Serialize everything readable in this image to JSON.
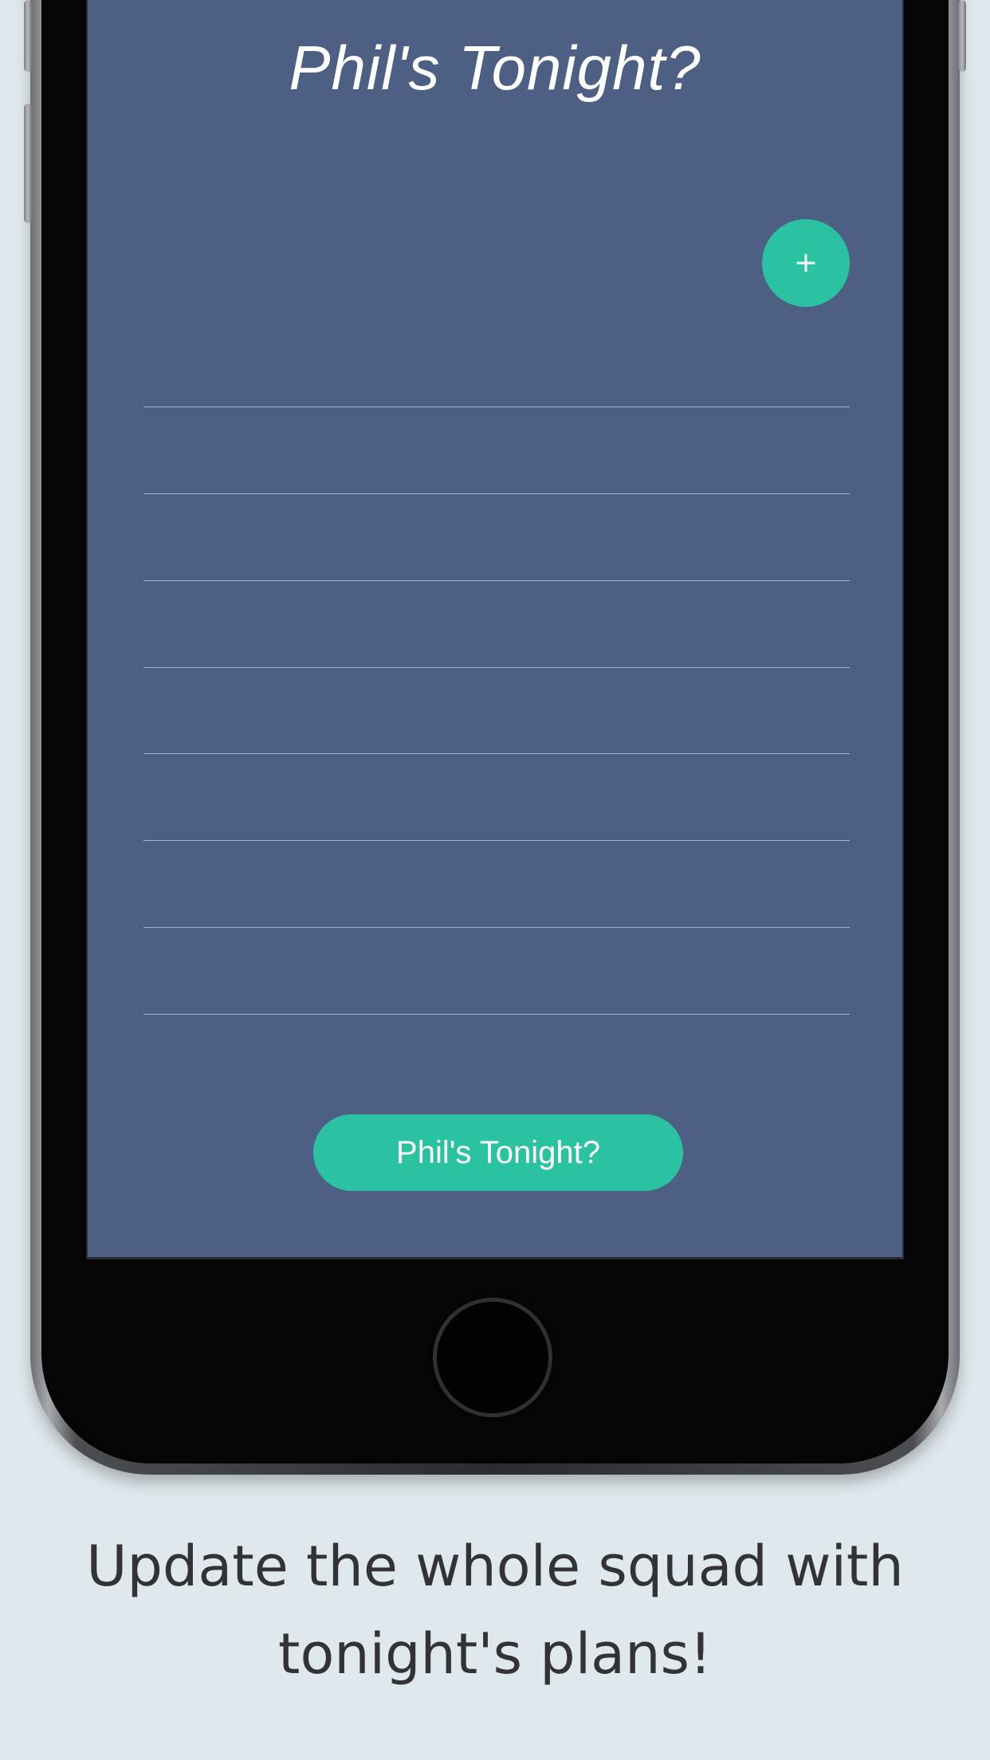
{
  "app": {
    "title": "Phil's Tonight?"
  },
  "add_button": {
    "icon": "plus-icon",
    "glyph": "+"
  },
  "plans": {
    "entries": [
      "",
      "",
      "",
      "",
      "",
      "",
      "",
      ""
    ]
  },
  "submit_button": {
    "label": "Phil's Tonight?"
  },
  "caption": {
    "line1": "Update the whole squad with",
    "line2": "tonight's plans!"
  },
  "colors": {
    "screen_bg": "#4d6083",
    "accent": "#2ac2a0",
    "page_bg": "#dfe8ed",
    "caption_text": "#333336"
  }
}
